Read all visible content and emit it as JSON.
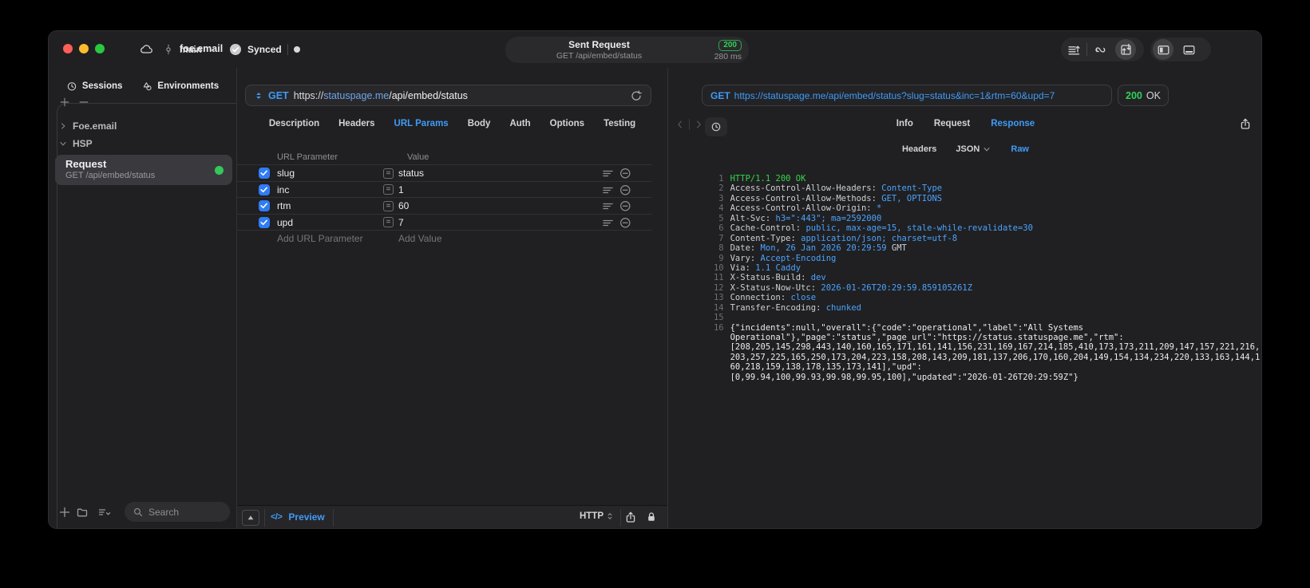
{
  "colors": {
    "accent_blue": "#3f9bf5",
    "status_green": "#30d158",
    "checkbox_blue": "#2f7cf6",
    "request_dot_green": "#34c759",
    "traffic_red": "#ff5f57",
    "traffic_yellow": "#febc2e",
    "traffic_green": "#28c840"
  },
  "titlebar": {
    "project": "foe.email",
    "branch": "main",
    "synced_label": "Synced",
    "request_pill": {
      "title": "Sent Request",
      "subtitle": "GET /api/embed/status",
      "status_code": "200",
      "duration": "280 ms"
    }
  },
  "sidebar": {
    "tabs": [
      {
        "label": "Sessions",
        "icon": "clock-icon",
        "active": true
      },
      {
        "label": "Environments",
        "icon": "shapes-icon",
        "active": false
      }
    ],
    "tree": [
      {
        "type": "group",
        "label": "Foe.email",
        "expanded": false
      },
      {
        "type": "group",
        "label": "HSP",
        "expanded": true
      },
      {
        "type": "request",
        "title": "Request",
        "subtitle": "GET /api/embed/status",
        "selected": true
      }
    ],
    "search": {
      "placeholder": "Search"
    }
  },
  "request_editor": {
    "method": "GET",
    "url_scheme": "https://",
    "url_host": "statuspage.me",
    "url_path": "/api/embed/status",
    "tabs": [
      {
        "label": "Description"
      },
      {
        "label": "Headers"
      },
      {
        "label": "URL Params",
        "active": true
      },
      {
        "label": "Body"
      },
      {
        "label": "Auth"
      },
      {
        "label": "Options"
      },
      {
        "label": "Testing"
      }
    ],
    "params_table": {
      "columns": [
        "URL Parameter",
        "Value"
      ],
      "rows": [
        {
          "checked": true,
          "name": "slug",
          "value": "status"
        },
        {
          "checked": true,
          "name": "inc",
          "value": "1"
        },
        {
          "checked": true,
          "name": "rtm",
          "value": "60"
        },
        {
          "checked": true,
          "name": "upd",
          "value": "7"
        }
      ],
      "add_row": {
        "name_placeholder": "Add URL Parameter",
        "value_placeholder": "Add Value"
      }
    },
    "footer": {
      "code_glyph": "</>",
      "preview_label": "Preview",
      "protocol_select": "HTTP"
    }
  },
  "response_panel": {
    "request_bar": {
      "method": "GET",
      "url": "https://statuspage.me/api/embed/status?slug=status&inc=1&rtm=60&upd=7"
    },
    "status_badge": {
      "code": "200",
      "text": "OK"
    },
    "tabs": [
      {
        "label": "Info"
      },
      {
        "label": "Request"
      },
      {
        "label": "Response",
        "active": true
      }
    ],
    "subtabs": [
      {
        "label": "Headers"
      },
      {
        "label": "JSON",
        "dropdown": true
      },
      {
        "label": "Raw",
        "active": true
      }
    ],
    "lines": [
      {
        "num": "1",
        "parts": [
          [
            "HTTP/1.1 200 OK",
            "s"
          ]
        ]
      },
      {
        "num": "2",
        "parts": [
          [
            "Access-Control-Allow-Headers: ",
            "n"
          ],
          [
            "Content-Type",
            "v"
          ]
        ]
      },
      {
        "num": "3",
        "parts": [
          [
            "Access-Control-Allow-Methods: ",
            "n"
          ],
          [
            "GET, OPTIONS",
            "v"
          ]
        ]
      },
      {
        "num": "4",
        "parts": [
          [
            "Access-Control-Allow-Origin: ",
            "n"
          ],
          [
            "*",
            "v"
          ]
        ]
      },
      {
        "num": "5",
        "parts": [
          [
            "Alt-Svc: ",
            "n"
          ],
          [
            "h3=\":443\"; ma=2592000",
            "v"
          ]
        ]
      },
      {
        "num": "6",
        "parts": [
          [
            "Cache-Control: ",
            "n"
          ],
          [
            "public, max-age=15, stale-while-revalidate=30",
            "v"
          ]
        ]
      },
      {
        "num": "7",
        "parts": [
          [
            "Content-Type: ",
            "n"
          ],
          [
            "application/json; charset=utf-8",
            "v"
          ]
        ]
      },
      {
        "num": "8",
        "parts": [
          [
            "Date: ",
            "n"
          ],
          [
            "Mon, 26 Jan 2026 20:29:59",
            "v"
          ],
          [
            " GMT",
            "n"
          ]
        ]
      },
      {
        "num": "9",
        "parts": [
          [
            "Vary: ",
            "n"
          ],
          [
            "Accept-Encoding",
            "v"
          ]
        ]
      },
      {
        "num": "10",
        "parts": [
          [
            "Via: ",
            "n"
          ],
          [
            "1.1 Caddy",
            "v"
          ]
        ]
      },
      {
        "num": "11",
        "parts": [
          [
            "X-Status-Build: ",
            "n"
          ],
          [
            "dev",
            "v"
          ]
        ]
      },
      {
        "num": "12",
        "parts": [
          [
            "X-Status-Now-Utc: ",
            "n"
          ],
          [
            "2026-01-26T20:29:59.859105261Z",
            "v"
          ]
        ]
      },
      {
        "num": "13",
        "parts": [
          [
            "Connection: ",
            "n"
          ],
          [
            "close",
            "v"
          ]
        ]
      },
      {
        "num": "14",
        "parts": [
          [
            "Transfer-Encoding: ",
            "n"
          ],
          [
            "chunked",
            "v"
          ]
        ]
      },
      {
        "num": "15",
        "parts": []
      },
      {
        "num": "16",
        "parts": [
          [
            "{\"incidents\":null,\"overall\":{\"code\":\"operational\",\"label\":\"All Systems",
            "b"
          ]
        ]
      },
      {
        "num": "",
        "parts": [
          [
            "Operational\"},\"page\":\"status\",\"page_url\":\"https://status.statuspage.me\",\"rtm\":",
            "b"
          ]
        ]
      },
      {
        "num": "",
        "parts": [
          [
            "[208,205,145,298,443,140,160,165,171,161,141,156,231,169,167,214,185,410,173,173,211,209,147,157,221,216,",
            "b"
          ]
        ]
      },
      {
        "num": "",
        "parts": [
          [
            "203,257,225,165,250,173,204,223,158,208,143,209,181,137,206,170,160,204,149,154,134,234,220,133,163,144,1",
            "b"
          ]
        ]
      },
      {
        "num": "",
        "parts": [
          [
            "60,218,159,138,178,135,173,141],\"upd\":",
            "b"
          ]
        ]
      },
      {
        "num": "",
        "parts": [
          [
            "[0,99.94,100,99.93,99.98,99.95,100],\"updated\":\"2026-01-26T20:29:59Z\"}",
            "b"
          ]
        ]
      }
    ]
  }
}
